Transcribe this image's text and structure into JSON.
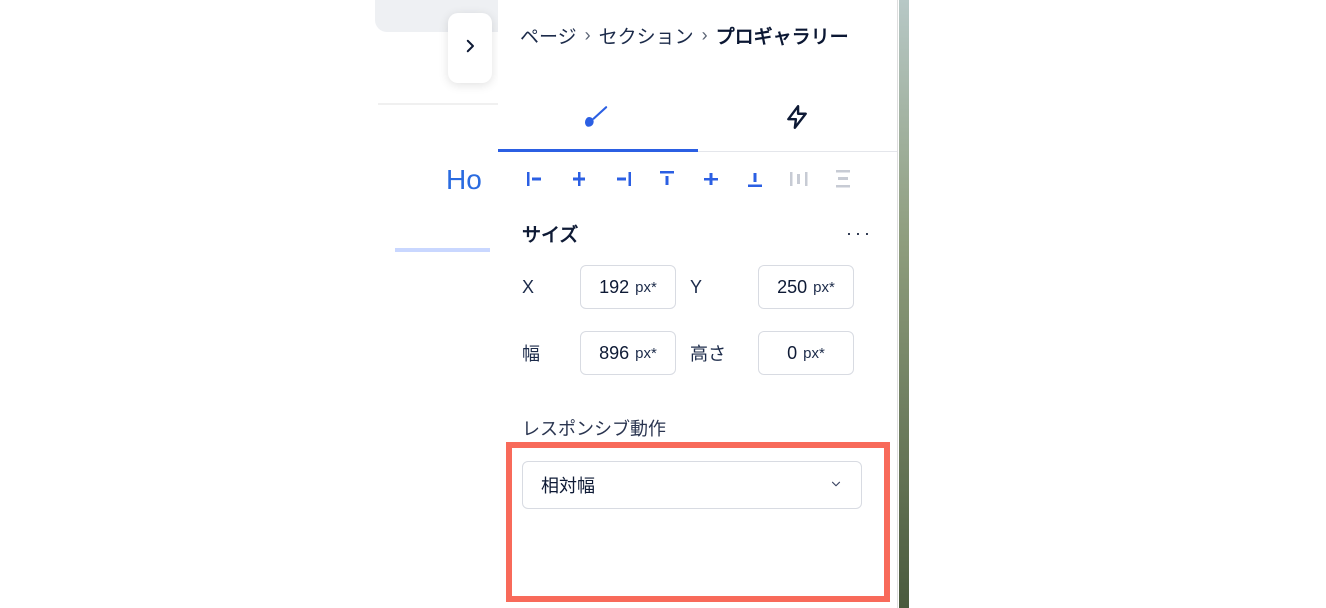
{
  "bg_link_text": "Ho",
  "breadcrumb": {
    "items": [
      "ページ",
      "セクション",
      "プロギャラリー"
    ],
    "separator": "›"
  },
  "tabs": {
    "design_icon": "brush-icon",
    "interaction_icon": "lightning-icon"
  },
  "size_section": {
    "title": "サイズ",
    "more": "···",
    "x_label": "X",
    "x_value": "192",
    "x_unit": "px*",
    "y_label": "Y",
    "y_value": "250",
    "y_unit": "px*",
    "w_label": "幅",
    "w_value": "896",
    "w_unit": "px*",
    "h_label": "高さ",
    "h_value": "0",
    "h_unit": "px*"
  },
  "responsive": {
    "title": "レスポンシブ動作",
    "selected": "相対幅"
  }
}
